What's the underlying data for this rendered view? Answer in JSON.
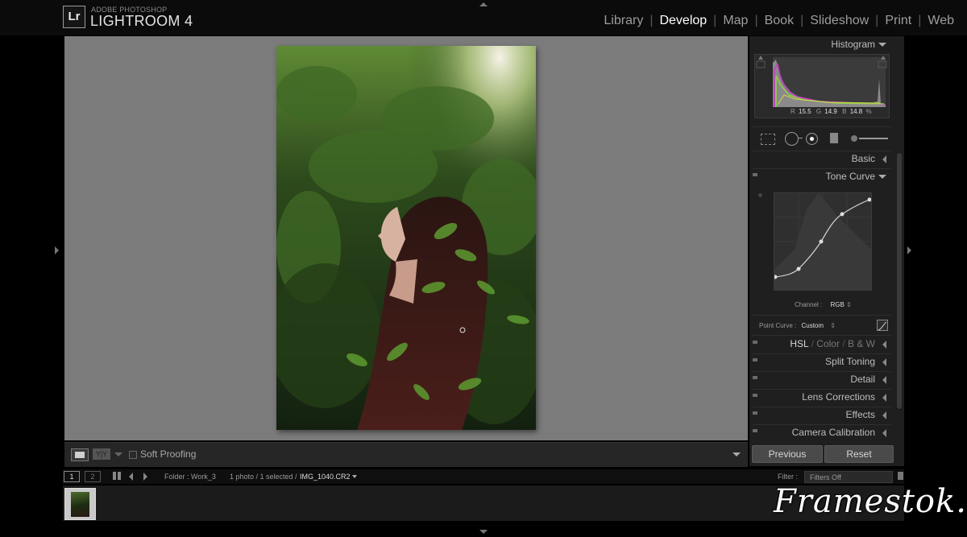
{
  "app": {
    "logo": "Lr",
    "brand_small": "ADOBE PHOTOSHOP",
    "brand_name": "LIGHTROOM 4"
  },
  "modules": [
    "Library",
    "Develop",
    "Map",
    "Book",
    "Slideshow",
    "Print",
    "Web"
  ],
  "active_module": "Develop",
  "toolbar": {
    "view_yy": "Y|Y",
    "soft_proofing_label": "Soft Proofing"
  },
  "right_panel": {
    "histogram": {
      "title": "Histogram",
      "r_label": "R",
      "r_value": "15.5",
      "g_label": "G",
      "g_value": "14.9",
      "b_label": "B",
      "b_value": "14.8",
      "unit": "%"
    },
    "basic_title": "Basic",
    "tone_curve": {
      "title": "Tone Curve",
      "channel_label": "Channel :",
      "channel_value": "RGB",
      "point_curve_label": "Point Curve :",
      "point_curve_value": "Custom"
    },
    "hsl": {
      "hsl": "HSL",
      "color": "Color",
      "bw": "B & W"
    },
    "sections": [
      "Split Toning",
      "Detail",
      "Lens Corrections",
      "Effects",
      "Camera Calibration"
    ],
    "previous_button": "Previous",
    "reset_button": "Reset"
  },
  "filmstrip_bar": {
    "page1": "1",
    "page2": "2",
    "folder": "Folder : Work_3",
    "count": "1 photo / 1 selected /",
    "filename": "IMG_1040.CR2",
    "filter_label": "Filter :",
    "filter_value": "Filters Off"
  },
  "watermark": "Framestok.ru",
  "colors": {
    "background_gray": "#7b7b7b",
    "panel": "#1f1f1f",
    "active_module": "#ffffff"
  }
}
